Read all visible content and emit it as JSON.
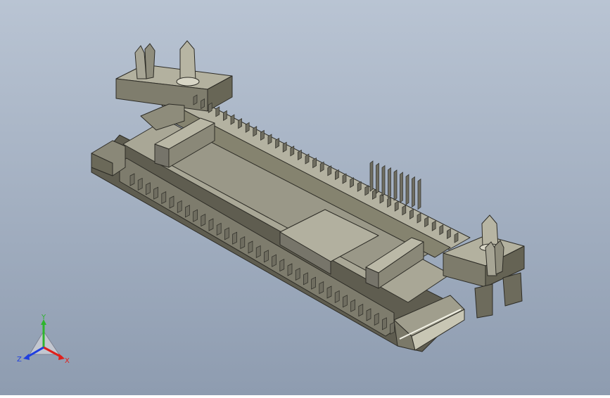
{
  "viewport": {
    "background_top": "#b9c4d3",
    "background_bottom": "#8e9cb0",
    "model_body_color": "#8f8d7d",
    "model_light_color": "#a9a796",
    "model_dark_color": "#5f5d50",
    "contact_color": "#6f6d60",
    "edge_color": "#2d2c26"
  },
  "triad": {
    "icon": "coordinate-triad-icon",
    "x_label": "X",
    "y_label": "Y",
    "z_label": "Z",
    "x_color": "#e0201b",
    "y_color": "#2fb52f",
    "z_color": "#1f3fe0"
  }
}
